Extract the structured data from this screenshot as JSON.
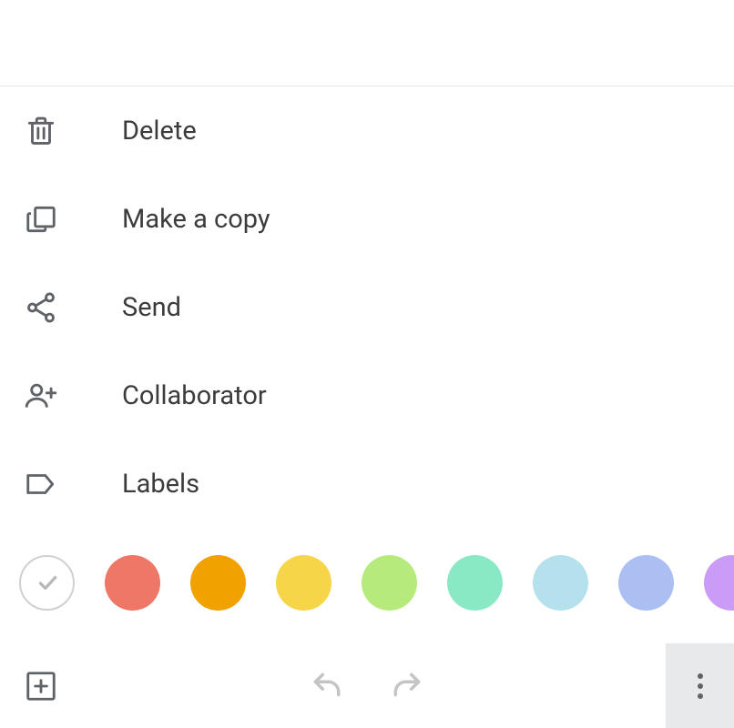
{
  "menu": {
    "items": [
      {
        "id": "delete",
        "label": "Delete",
        "icon": "trash"
      },
      {
        "id": "copy",
        "label": "Make a copy",
        "icon": "copy"
      },
      {
        "id": "send",
        "label": "Send",
        "icon": "share"
      },
      {
        "id": "collaborator",
        "label": "Collaborator",
        "icon": "person-add"
      },
      {
        "id": "labels",
        "label": "Labels",
        "icon": "label"
      }
    ]
  },
  "colors": {
    "selected_index": 0,
    "swatches": [
      {
        "id": "white",
        "hex": "#ffffff",
        "selected": true
      },
      {
        "id": "coral",
        "hex": "#ef7768"
      },
      {
        "id": "orange",
        "hex": "#f2a200"
      },
      {
        "id": "yellow",
        "hex": "#f7d548"
      },
      {
        "id": "green",
        "hex": "#b6ea7c"
      },
      {
        "id": "teal",
        "hex": "#8ae9c5"
      },
      {
        "id": "lightblue",
        "hex": "#b5e1ed"
      },
      {
        "id": "blue",
        "hex": "#abbff2"
      },
      {
        "id": "purple",
        "hex": "#cb9cf7"
      }
    ]
  },
  "bottom_bar": {
    "add": "add",
    "undo": "undo",
    "redo": "redo",
    "more": "more"
  }
}
